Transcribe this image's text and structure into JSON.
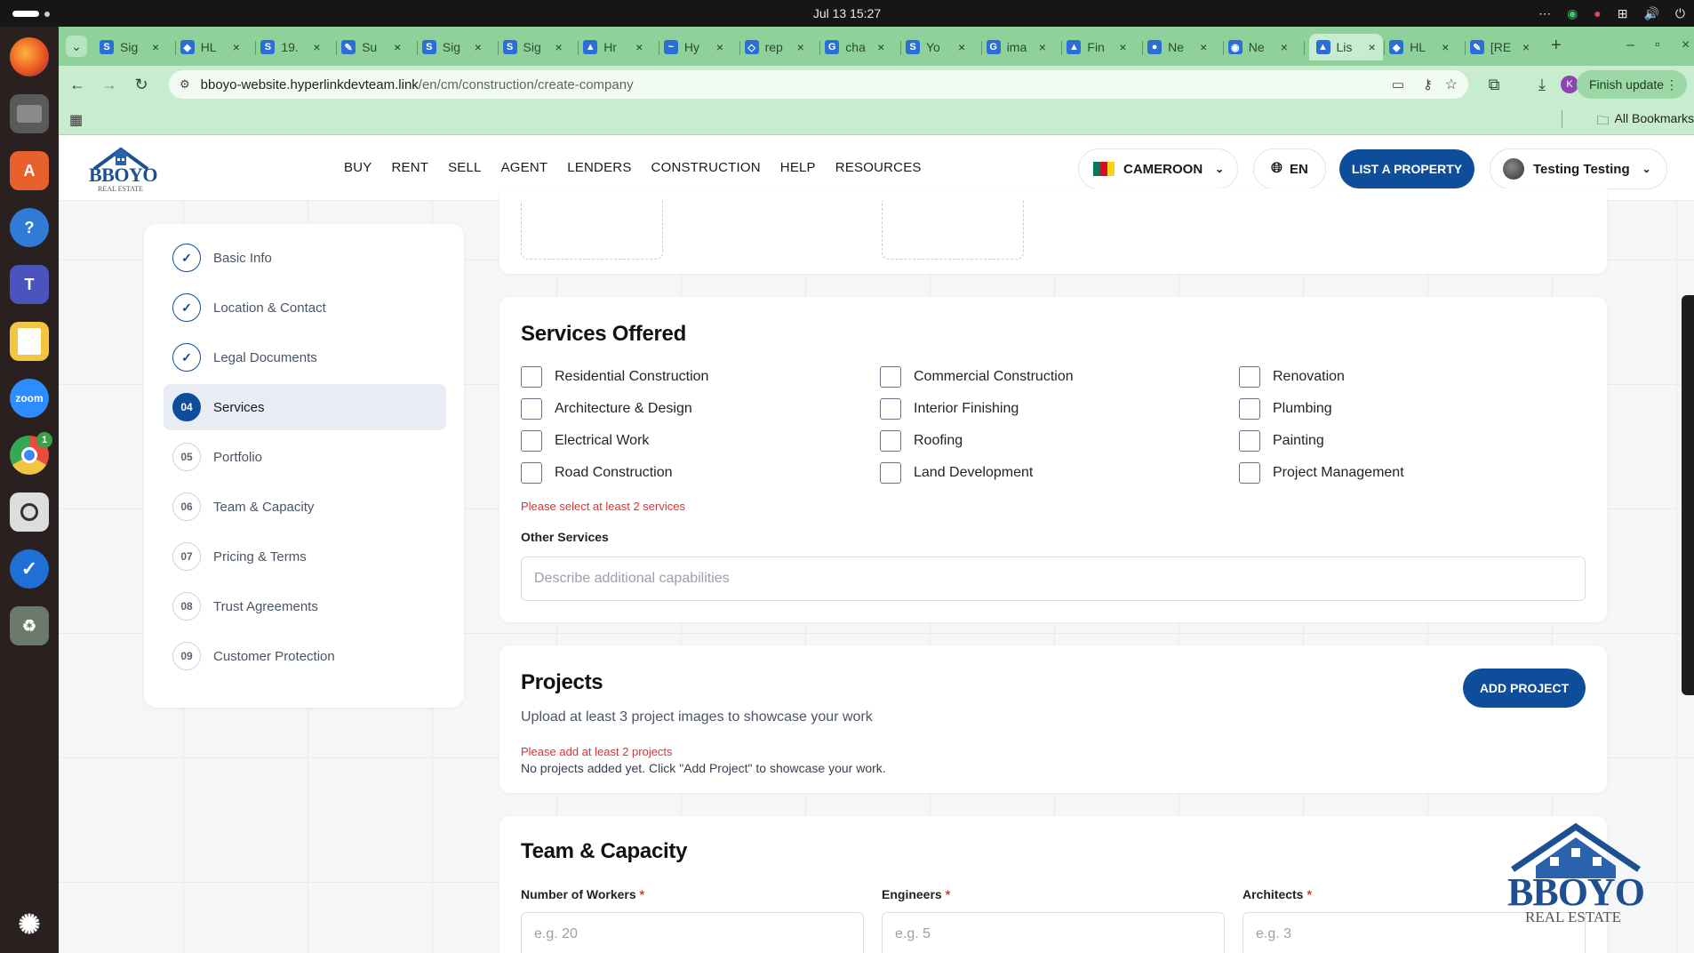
{
  "system": {
    "clock": "Jul 13  15:27",
    "tray": [
      "⋯",
      "◉",
      "●",
      "⊞",
      "🔊",
      "⏻"
    ]
  },
  "dock": {
    "chrome_badge": "1",
    "teams_label": "T",
    "zoom_label": "zoom"
  },
  "browser": {
    "tabs": [
      {
        "icon": "S",
        "label": "Sig"
      },
      {
        "icon": "◆",
        "label": "HL"
      },
      {
        "icon": "S",
        "label": "19."
      },
      {
        "icon": "✎",
        "label": "Su"
      },
      {
        "icon": "S",
        "label": "Sig"
      },
      {
        "icon": "S",
        "label": "Sig"
      },
      {
        "icon": "▲",
        "label": "Hr"
      },
      {
        "icon": "~",
        "label": "Hy"
      },
      {
        "icon": "◇",
        "label": "rep"
      },
      {
        "icon": "G",
        "label": "cha"
      },
      {
        "icon": "S",
        "label": "Yo"
      },
      {
        "icon": "G",
        "label": "ima"
      },
      {
        "icon": "▲",
        "label": "Fin"
      },
      {
        "icon": "●",
        "label": "Ne"
      },
      {
        "icon": "◉",
        "label": "Ne"
      },
      {
        "icon": "▲",
        "label": "Lis"
      },
      {
        "icon": "◆",
        "label": "HL"
      },
      {
        "icon": "✎",
        "label": "[RE"
      }
    ],
    "new_tab": "+",
    "url_host": "bboyo-website.hyperlinkdevteam.link",
    "url_path": "/en/cm/construction/create-company",
    "profile_initial": "K",
    "finish_update": "Finish update",
    "all_bookmarks": "All Bookmarks"
  },
  "header": {
    "logo_text": "BBOYO",
    "logo_sub": "REAL ESTATE",
    "nav": [
      "BUY",
      "RENT",
      "SELL",
      "AGENT",
      "LENDERS",
      "CONSTRUCTION",
      "HELP",
      "RESOURCES"
    ],
    "country": "CAMEROON",
    "language": "EN",
    "list_property": "LIST A PROPERTY",
    "user_name": "Testing Testing"
  },
  "steps": [
    {
      "num": "✓",
      "label": "Basic Info",
      "state": "done"
    },
    {
      "num": "✓",
      "label": "Location & Contact",
      "state": "done"
    },
    {
      "num": "✓",
      "label": "Legal Documents",
      "state": "done"
    },
    {
      "num": "04",
      "label": "Services",
      "state": "current"
    },
    {
      "num": "05",
      "label": "Portfolio",
      "state": "todo"
    },
    {
      "num": "06",
      "label": "Team & Capacity",
      "state": "todo"
    },
    {
      "num": "07",
      "label": "Pricing & Terms",
      "state": "todo"
    },
    {
      "num": "08",
      "label": "Trust Agreements",
      "state": "todo"
    },
    {
      "num": "09",
      "label": "Customer Protection",
      "state": "todo"
    }
  ],
  "services": {
    "title": "Services Offered",
    "options": [
      "Residential Construction",
      "Commercial Construction",
      "Renovation",
      "Architecture & Design",
      "Interior Finishing",
      "Plumbing",
      "Electrical Work",
      "Roofing",
      "Painting",
      "Road Construction",
      "Land Development",
      "Project Management"
    ],
    "error": "Please select at least 2 services",
    "other_label": "Other Services",
    "other_placeholder": "Describe additional capabilities"
  },
  "projects": {
    "title": "Projects",
    "add_button": "ADD PROJECT",
    "subtitle": "Upload at least 3 project images to showcase your work",
    "error": "Please add at least 2 projects",
    "empty": "No projects added yet. Click \"Add Project\" to showcase your work."
  },
  "team": {
    "title": "Team & Capacity",
    "fields": [
      {
        "label": "Number of Workers",
        "required": "*",
        "placeholder": "e.g. 20"
      },
      {
        "label": "Engineers",
        "required": "*",
        "placeholder": "e.g. 5"
      },
      {
        "label": "Architects",
        "required": "*",
        "placeholder": "e.g. 3"
      }
    ]
  },
  "watermark": {
    "text": "BBOYO",
    "sub": "REAL ESTATE"
  },
  "colors": {
    "brand": "#0d4d9a",
    "error": "#e03131",
    "browser_green": "#8fd19a"
  }
}
